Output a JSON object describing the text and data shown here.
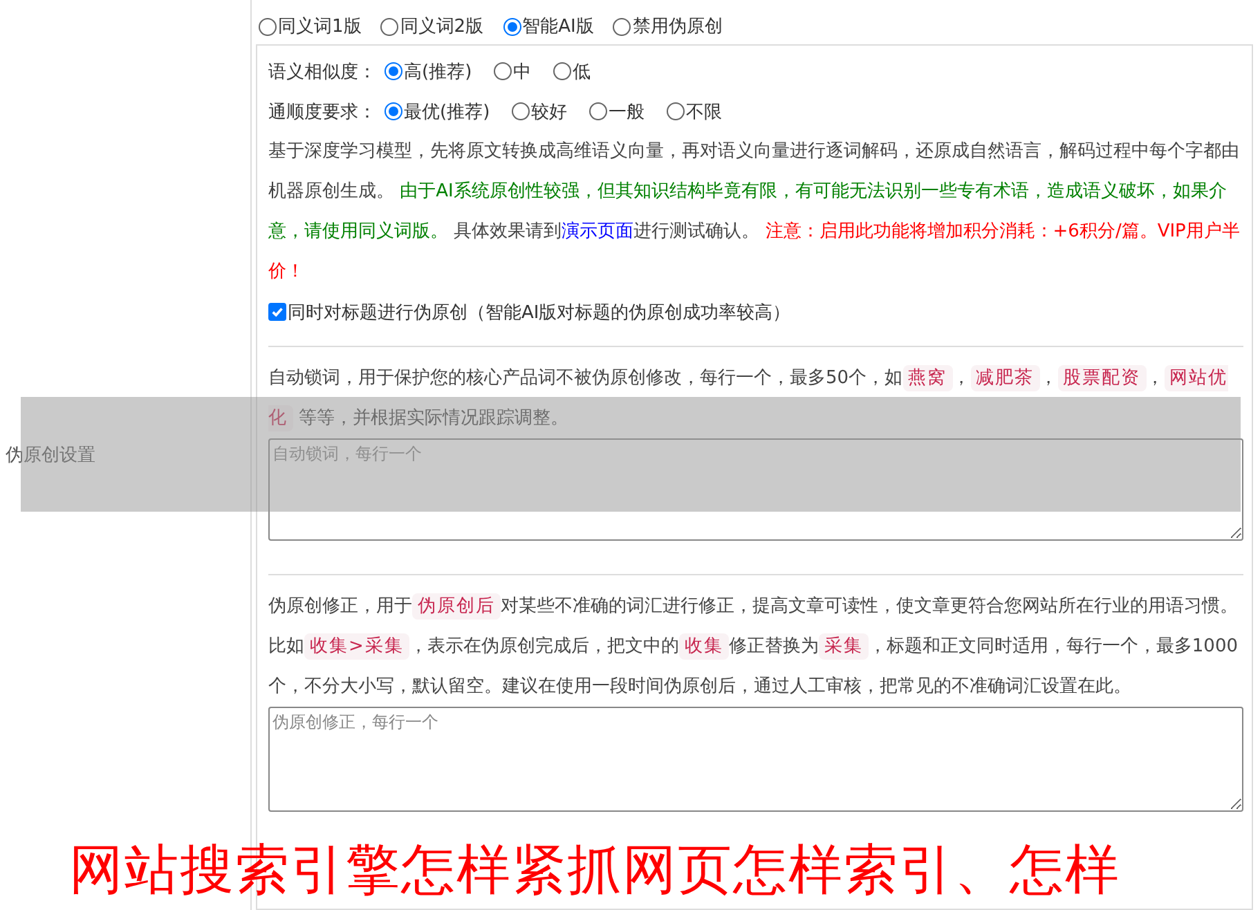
{
  "section_label": "伪原创设置",
  "modes": [
    {
      "label": "同义词1版",
      "selected": false
    },
    {
      "label": "同义词2版",
      "selected": false
    },
    {
      "label": "智能AI版",
      "selected": true
    },
    {
      "label": "禁用伪原创",
      "selected": false
    }
  ],
  "similarity": {
    "label": "语义相似度：",
    "options": [
      {
        "label": "高(推荐)",
        "selected": true
      },
      {
        "label": "中",
        "selected": false
      },
      {
        "label": "低",
        "selected": false
      }
    ]
  },
  "fluency": {
    "label": "通顺度要求：",
    "options": [
      {
        "label": "最优(推荐)",
        "selected": true
      },
      {
        "label": "较好",
        "selected": false
      },
      {
        "label": "一般",
        "selected": false
      },
      {
        "label": "不限",
        "selected": false
      }
    ]
  },
  "ai_description": [
    {
      "kind": "plain",
      "text": "基于深度学习模型，先将原文转换成高维语义向量，再对语义向量进行逐词解码，还原成自然语言，解码过程中每个字都由机器原创生成。 "
    },
    {
      "kind": "green",
      "text": "由于AI系统原创性较强，但其知识结构毕竟有限，有可能无法识别一些专有术语，造成语义破坏，如果介意，请使用同义词版。"
    },
    {
      "kind": "plain",
      "text": " 具体效果请到"
    },
    {
      "kind": "link",
      "text": "演示页面"
    },
    {
      "kind": "plain",
      "text": "进行测试确认。 "
    },
    {
      "kind": "red",
      "text": "注意：启用此功能将增加积分消耗：+6积分/篇。VIP用户半价！"
    }
  ],
  "title_option": {
    "label": "同时对标题进行伪原创（智能AI版对标题的伪原创成功率较高）",
    "checked": true
  },
  "lock_description": [
    {
      "kind": "plain",
      "text": "自动锁词，用于保护您的核心产品词不被伪原创修改，每行一个，最多50个，如"
    },
    {
      "kind": "code",
      "text": "燕窝"
    },
    {
      "kind": "plain",
      "text": "，"
    },
    {
      "kind": "code",
      "text": "减肥茶"
    },
    {
      "kind": "plain",
      "text": "，"
    },
    {
      "kind": "code",
      "text": "股票配资"
    },
    {
      "kind": "plain",
      "text": "，"
    },
    {
      "kind": "code",
      "text": "网站优化"
    },
    {
      "kind": "plain",
      "text": " 等等，并根据实际情况跟踪调整。"
    }
  ],
  "lock_field": {
    "placeholder": "自动锁词，每行一个"
  },
  "fix_description": [
    {
      "kind": "plain",
      "text": "伪原创修正，用于"
    },
    {
      "kind": "code",
      "text": "伪原创后"
    },
    {
      "kind": "plain",
      "text": "对某些不准确的词汇进行修正，提高文章可读性，使文章更符合您网站所在行业的用语习惯。比如"
    },
    {
      "kind": "code",
      "text": "收集>采集"
    },
    {
      "kind": "plain",
      "text": "，表示在伪原创完成后，把文中的"
    },
    {
      "kind": "code",
      "text": "收集"
    },
    {
      "kind": "plain",
      "text": "修正替换为"
    },
    {
      "kind": "code",
      "text": "采集"
    },
    {
      "kind": "plain",
      "text": "，标题和正文同时适用，每行一个，最多1000个，不分大小写，默认留空。建议在使用一段时间伪原创后，通过人工审核，把常见的不准确词汇设置在此。"
    }
  ],
  "fix_field": {
    "placeholder": "伪原创修正，每行一个"
  },
  "caption": "网站搜索引擎怎样紧抓网页怎样索引、怎样"
}
